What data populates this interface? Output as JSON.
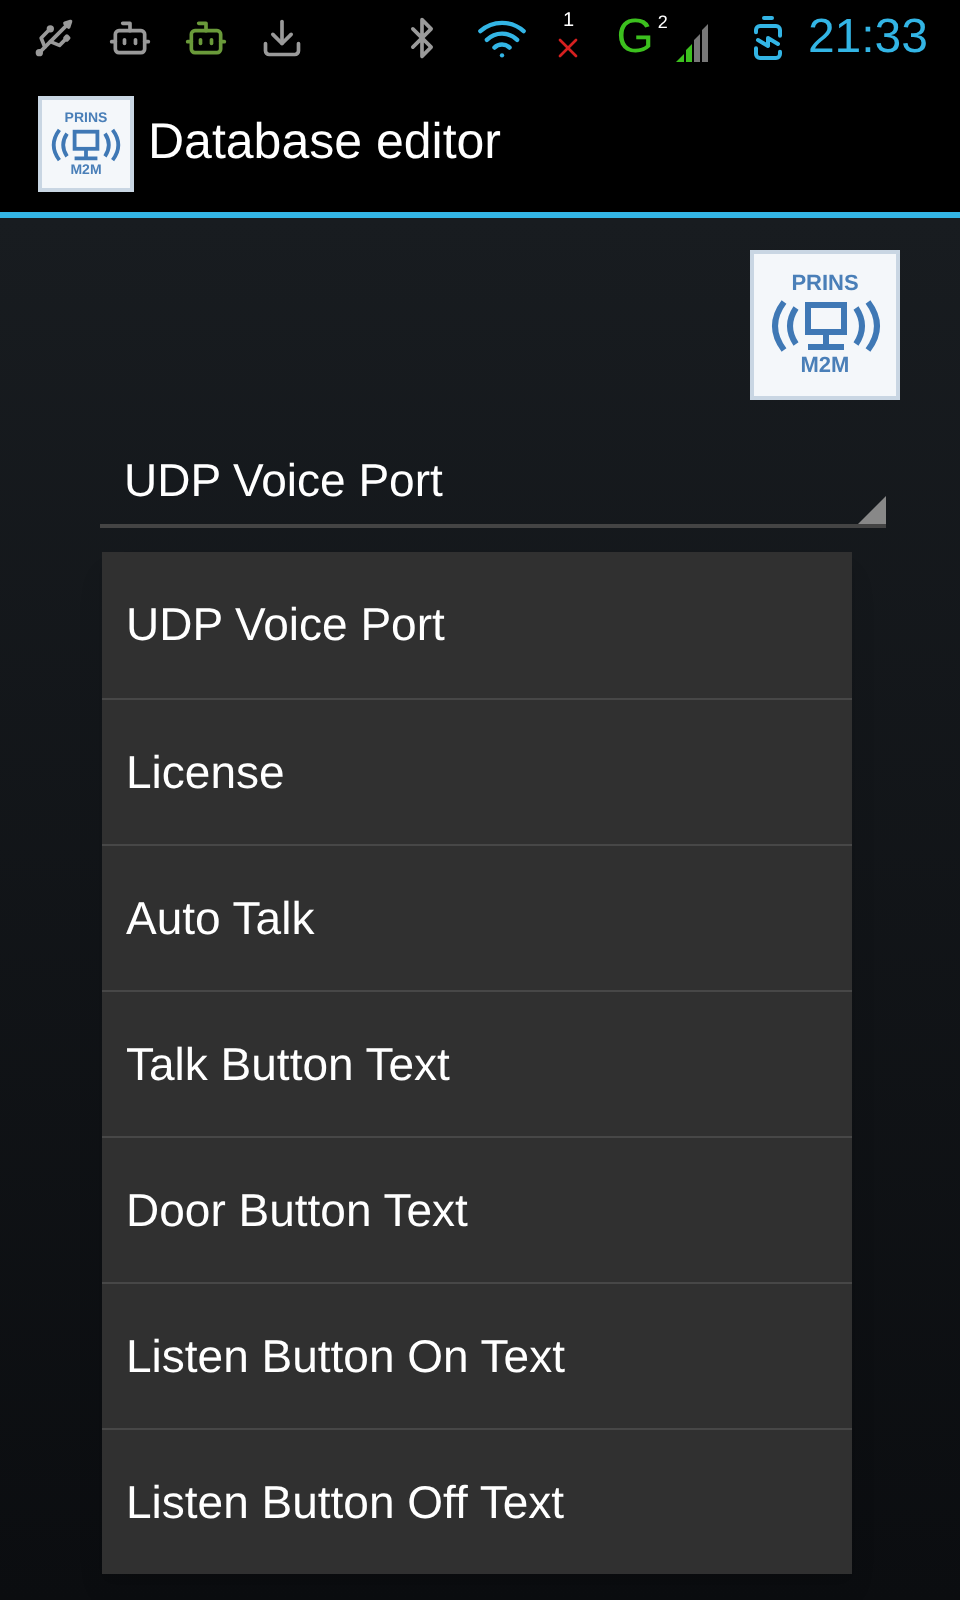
{
  "status_bar": {
    "missed_count": "1",
    "network_type": "G",
    "sim_slot": "2",
    "time": "21:33"
  },
  "action_bar": {
    "title": "Database editor",
    "logo": {
      "top_text": "PRINS",
      "bottom_text": "M2M"
    }
  },
  "logo": {
    "top_text": "PRINS",
    "bottom_text": "M2M"
  },
  "spinner": {
    "value": "UDP Voice Port"
  },
  "dropdown": {
    "items": [
      {
        "label": "UDP Voice Port"
      },
      {
        "label": "License"
      },
      {
        "label": "Auto Talk"
      },
      {
        "label": "Talk Button Text"
      },
      {
        "label": "Door Button Text"
      },
      {
        "label": "Listen Button On Text"
      },
      {
        "label": "Listen Button Off Text"
      }
    ]
  }
}
